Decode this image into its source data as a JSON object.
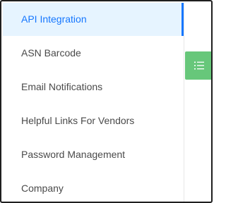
{
  "menu": {
    "items": [
      {
        "label": "API Integration",
        "active": true
      },
      {
        "label": "ASN Barcode",
        "active": false
      },
      {
        "label": "Email Notifications",
        "active": false
      },
      {
        "label": "Helpful Links For Vendors",
        "active": false
      },
      {
        "label": "Password Management",
        "active": false
      },
      {
        "label": "Company",
        "active": false
      }
    ]
  },
  "toggle": {
    "icon": "list-icon",
    "color": "#67c77a"
  },
  "colors": {
    "accent": "#1677ff",
    "active_bg": "#e6f4ff",
    "text": "#4a4a4a"
  }
}
